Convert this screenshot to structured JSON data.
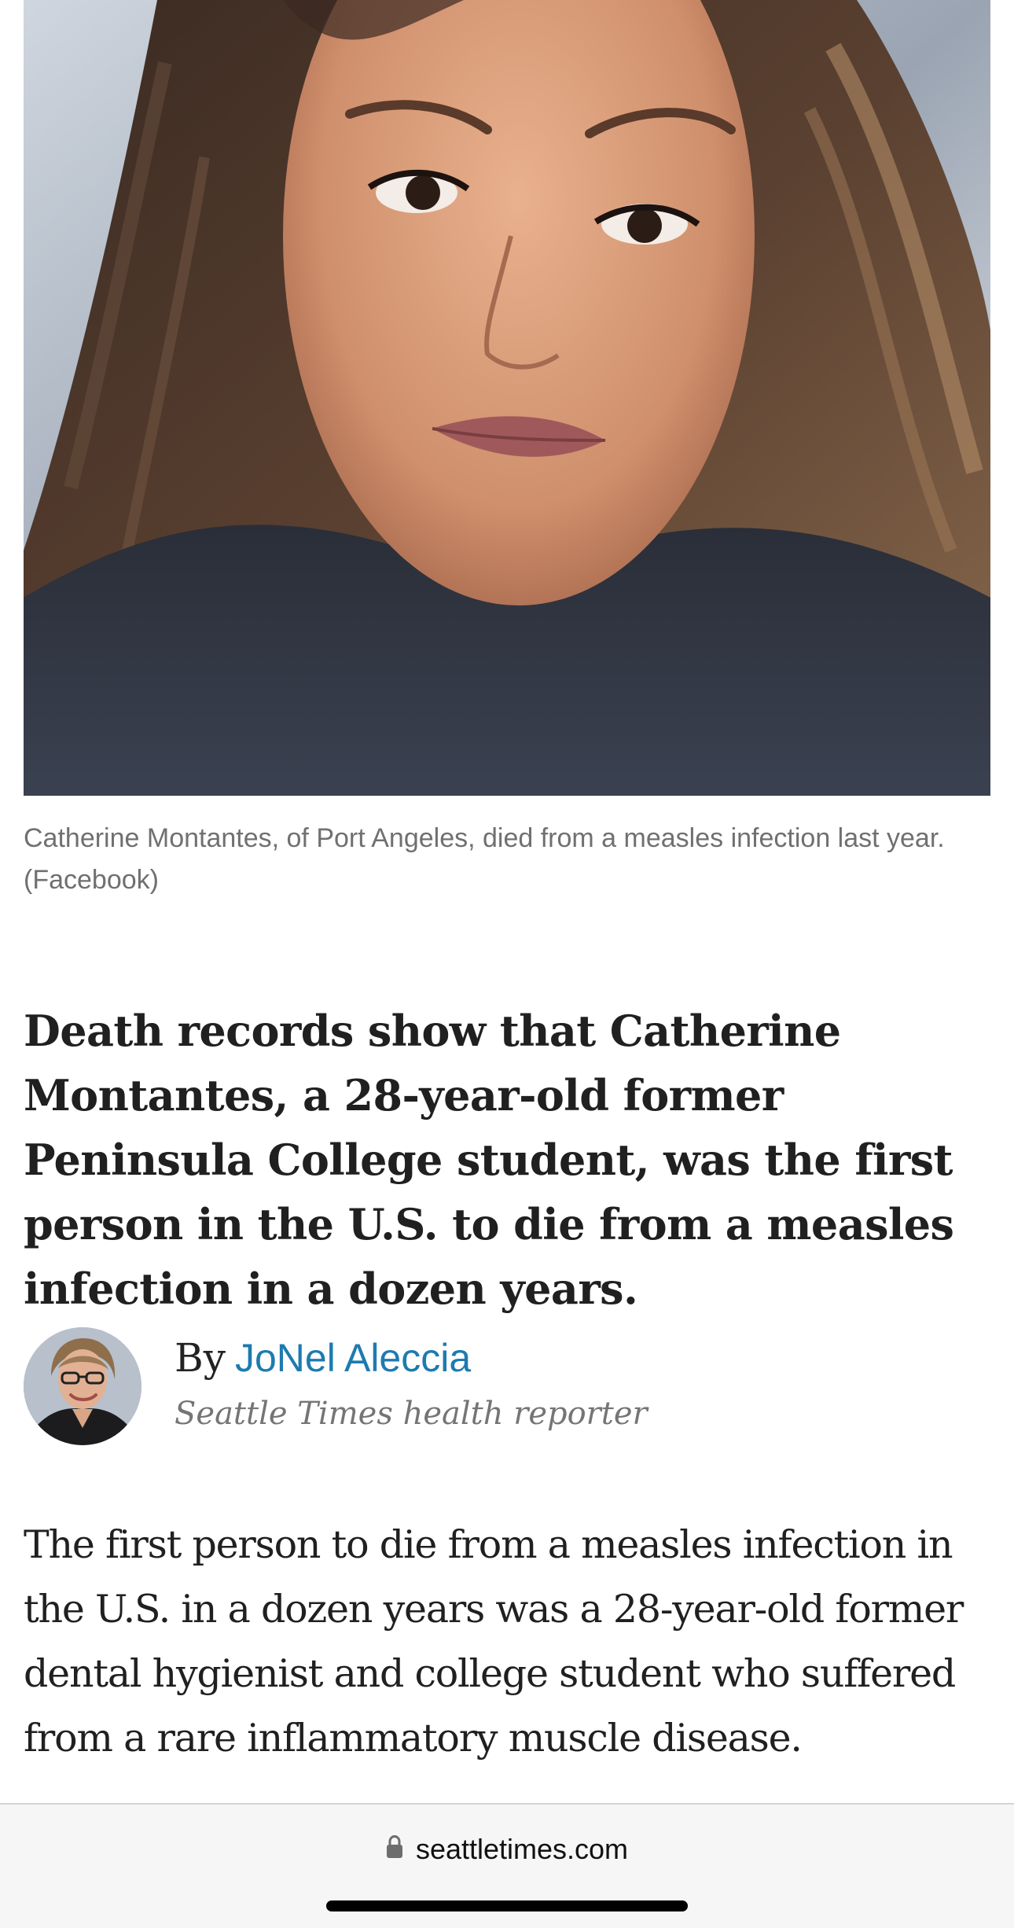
{
  "article": {
    "photo_icon": "woman-portrait-photo",
    "caption": "Catherine Montantes, of Port Angeles, died from a measles infection last year. (Facebook)",
    "headline": "Death records show that Catherine Montantes, a 28-year-old former Peninsula College student, was the first person in the U.S. to die from a measles infection in a dozen years.",
    "byline": {
      "prefix": "By",
      "author": "JoNel Aleccia",
      "title": "Seattle Times health reporter",
      "avatar_icon": "author-headshot"
    },
    "body": "The first person to die from a measles infection in the U.S. in a dozen years was a 28-year-old former dental hygienist and college student who suffered from a rare inflammatory muscle disease."
  },
  "browser": {
    "url": "seattletimes.com",
    "lock_icon": "lock-icon"
  },
  "colors": {
    "link": "#1d7bb0",
    "caption": "#707070",
    "text": "#202020",
    "bar_background": "#f6f6f6"
  }
}
